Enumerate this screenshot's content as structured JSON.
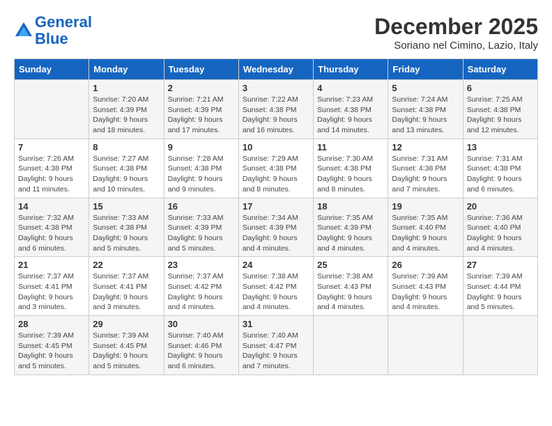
{
  "header": {
    "logo_line1": "General",
    "logo_line2": "Blue",
    "month_title": "December 2025",
    "subtitle": "Soriano nel Cimino, Lazio, Italy"
  },
  "weekdays": [
    "Sunday",
    "Monday",
    "Tuesday",
    "Wednesday",
    "Thursday",
    "Friday",
    "Saturday"
  ],
  "weeks": [
    [
      {
        "day": "",
        "info": ""
      },
      {
        "day": "1",
        "info": "Sunrise: 7:20 AM\nSunset: 4:39 PM\nDaylight: 9 hours\nand 18 minutes."
      },
      {
        "day": "2",
        "info": "Sunrise: 7:21 AM\nSunset: 4:39 PM\nDaylight: 9 hours\nand 17 minutes."
      },
      {
        "day": "3",
        "info": "Sunrise: 7:22 AM\nSunset: 4:38 PM\nDaylight: 9 hours\nand 16 minutes."
      },
      {
        "day": "4",
        "info": "Sunrise: 7:23 AM\nSunset: 4:38 PM\nDaylight: 9 hours\nand 14 minutes."
      },
      {
        "day": "5",
        "info": "Sunrise: 7:24 AM\nSunset: 4:38 PM\nDaylight: 9 hours\nand 13 minutes."
      },
      {
        "day": "6",
        "info": "Sunrise: 7:25 AM\nSunset: 4:38 PM\nDaylight: 9 hours\nand 12 minutes."
      }
    ],
    [
      {
        "day": "7",
        "info": "Sunrise: 7:26 AM\nSunset: 4:38 PM\nDaylight: 9 hours\nand 11 minutes."
      },
      {
        "day": "8",
        "info": "Sunrise: 7:27 AM\nSunset: 4:38 PM\nDaylight: 9 hours\nand 10 minutes."
      },
      {
        "day": "9",
        "info": "Sunrise: 7:28 AM\nSunset: 4:38 PM\nDaylight: 9 hours\nand 9 minutes."
      },
      {
        "day": "10",
        "info": "Sunrise: 7:29 AM\nSunset: 4:38 PM\nDaylight: 9 hours\nand 8 minutes."
      },
      {
        "day": "11",
        "info": "Sunrise: 7:30 AM\nSunset: 4:38 PM\nDaylight: 9 hours\nand 8 minutes."
      },
      {
        "day": "12",
        "info": "Sunrise: 7:31 AM\nSunset: 4:38 PM\nDaylight: 9 hours\nand 7 minutes."
      },
      {
        "day": "13",
        "info": "Sunrise: 7:31 AM\nSunset: 4:38 PM\nDaylight: 9 hours\nand 6 minutes."
      }
    ],
    [
      {
        "day": "14",
        "info": "Sunrise: 7:32 AM\nSunset: 4:38 PM\nDaylight: 9 hours\nand 6 minutes."
      },
      {
        "day": "15",
        "info": "Sunrise: 7:33 AM\nSunset: 4:38 PM\nDaylight: 9 hours\nand 5 minutes."
      },
      {
        "day": "16",
        "info": "Sunrise: 7:33 AM\nSunset: 4:39 PM\nDaylight: 9 hours\nand 5 minutes."
      },
      {
        "day": "17",
        "info": "Sunrise: 7:34 AM\nSunset: 4:39 PM\nDaylight: 9 hours\nand 4 minutes."
      },
      {
        "day": "18",
        "info": "Sunrise: 7:35 AM\nSunset: 4:39 PM\nDaylight: 9 hours\nand 4 minutes."
      },
      {
        "day": "19",
        "info": "Sunrise: 7:35 AM\nSunset: 4:40 PM\nDaylight: 9 hours\nand 4 minutes."
      },
      {
        "day": "20",
        "info": "Sunrise: 7:36 AM\nSunset: 4:40 PM\nDaylight: 9 hours\nand 4 minutes."
      }
    ],
    [
      {
        "day": "21",
        "info": "Sunrise: 7:37 AM\nSunset: 4:41 PM\nDaylight: 9 hours\nand 3 minutes."
      },
      {
        "day": "22",
        "info": "Sunrise: 7:37 AM\nSunset: 4:41 PM\nDaylight: 9 hours\nand 3 minutes."
      },
      {
        "day": "23",
        "info": "Sunrise: 7:37 AM\nSunset: 4:42 PM\nDaylight: 9 hours\nand 4 minutes."
      },
      {
        "day": "24",
        "info": "Sunrise: 7:38 AM\nSunset: 4:42 PM\nDaylight: 9 hours\nand 4 minutes."
      },
      {
        "day": "25",
        "info": "Sunrise: 7:38 AM\nSunset: 4:43 PM\nDaylight: 9 hours\nand 4 minutes."
      },
      {
        "day": "26",
        "info": "Sunrise: 7:39 AM\nSunset: 4:43 PM\nDaylight: 9 hours\nand 4 minutes."
      },
      {
        "day": "27",
        "info": "Sunrise: 7:39 AM\nSunset: 4:44 PM\nDaylight: 9 hours\nand 5 minutes."
      }
    ],
    [
      {
        "day": "28",
        "info": "Sunrise: 7:39 AM\nSunset: 4:45 PM\nDaylight: 9 hours\nand 5 minutes."
      },
      {
        "day": "29",
        "info": "Sunrise: 7:39 AM\nSunset: 4:45 PM\nDaylight: 9 hours\nand 5 minutes."
      },
      {
        "day": "30",
        "info": "Sunrise: 7:40 AM\nSunset: 4:46 PM\nDaylight: 9 hours\nand 6 minutes."
      },
      {
        "day": "31",
        "info": "Sunrise: 7:40 AM\nSunset: 4:47 PM\nDaylight: 9 hours\nand 7 minutes."
      },
      {
        "day": "",
        "info": ""
      },
      {
        "day": "",
        "info": ""
      },
      {
        "day": "",
        "info": ""
      }
    ]
  ]
}
